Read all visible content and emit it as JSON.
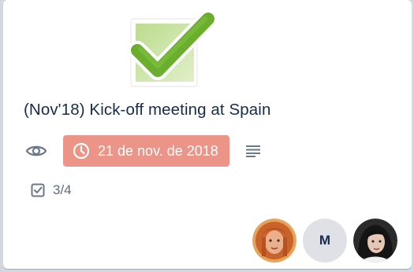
{
  "card": {
    "title": "(Nov'18) Kick-off meeting at Spain",
    "cover_icon": "green-checkmark-icon",
    "badges": {
      "watch_icon": "eye-icon",
      "due_icon": "clock-icon",
      "due_date": "21 de nov. de 2018",
      "due_color": "#ec9488",
      "description_icon": "description-lines-icon"
    },
    "checklist": {
      "icon": "checkbox-icon",
      "progress": "3/4"
    },
    "members": [
      {
        "type": "photo",
        "name": "member-1"
      },
      {
        "type": "initial",
        "initial": "M"
      },
      {
        "type": "photo",
        "name": "member-3"
      }
    ]
  }
}
